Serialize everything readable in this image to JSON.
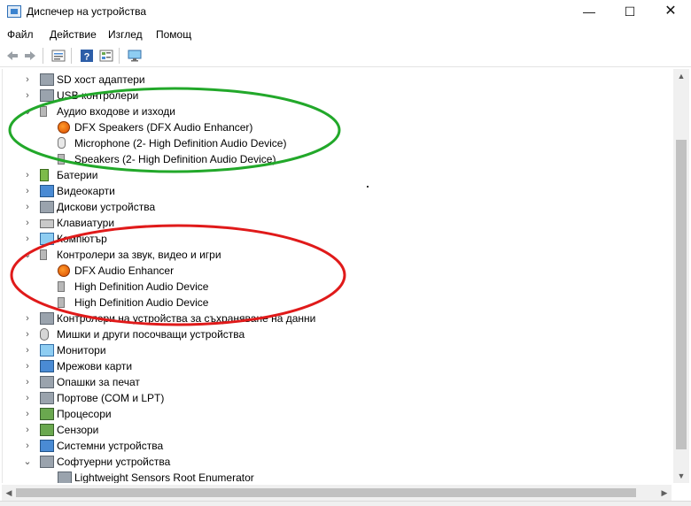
{
  "window": {
    "title": "Диспечер на устройства",
    "minimize_glyph": "—",
    "maximize_glyph": "☐",
    "close_glyph": "✕"
  },
  "menu": [
    "Файл",
    "Действие",
    "Изглед",
    "Помощ"
  ],
  "toolbar": {
    "icons": [
      "back-arrow-icon",
      "forward-arrow-icon",
      "properties-icon",
      "help-icon",
      "view-icon",
      "monitor-icon"
    ]
  },
  "tree": {
    "rows": [
      {
        "label": "SD хост адаптери",
        "level": 0,
        "state": "collapsed",
        "icon": "sd-card-icon"
      },
      {
        "label": "USB контролери",
        "level": 0,
        "state": "collapsed",
        "icon": "usb-icon"
      },
      {
        "label": "Аудио входове и изходи",
        "level": 0,
        "state": "expanded",
        "icon": "speaker-icon"
      },
      {
        "label": "DFX Speakers (DFX Audio Enhancer)",
        "level": 1,
        "state": "",
        "icon": "dfx-icon"
      },
      {
        "label": "Microphone (2- High Definition Audio Device)",
        "level": 1,
        "state": "",
        "icon": "microphone-icon"
      },
      {
        "label": "Speakers (2- High Definition Audio Device)",
        "level": 1,
        "state": "",
        "icon": "speaker-icon"
      },
      {
        "label": "Батерии",
        "level": 0,
        "state": "collapsed",
        "icon": "battery-icon"
      },
      {
        "label": "Видеокарти",
        "level": 0,
        "state": "collapsed",
        "icon": "display-adapter-icon"
      },
      {
        "label": "Дискови устройства",
        "level": 0,
        "state": "collapsed",
        "icon": "disk-drive-icon"
      },
      {
        "label": "Клавиатури",
        "level": 0,
        "state": "collapsed",
        "icon": "keyboard-icon"
      },
      {
        "label": "Компютър",
        "level": 0,
        "state": "collapsed",
        "icon": "computer-icon"
      },
      {
        "label": "Контролери за звук, видео и игри",
        "level": 0,
        "state": "expanded",
        "icon": "speaker-icon"
      },
      {
        "label": "DFX Audio Enhancer",
        "level": 1,
        "state": "",
        "icon": "dfx-icon"
      },
      {
        "label": "High Definition Audio Device",
        "level": 1,
        "state": "",
        "icon": "speaker-icon"
      },
      {
        "label": "High Definition Audio Device",
        "level": 1,
        "state": "",
        "icon": "speaker-icon"
      },
      {
        "label": "Контролери на устройства за съхраняване на данни",
        "level": 0,
        "state": "collapsed",
        "icon": "storage-controller-icon"
      },
      {
        "label": "Мишки и други посочващи устройства",
        "level": 0,
        "state": "collapsed",
        "icon": "mouse-icon"
      },
      {
        "label": "Монитори",
        "level": 0,
        "state": "collapsed",
        "icon": "monitor-icon"
      },
      {
        "label": "Мрежови карти",
        "level": 0,
        "state": "collapsed",
        "icon": "network-adapter-icon"
      },
      {
        "label": "Опашки за печат",
        "level": 0,
        "state": "collapsed",
        "icon": "printer-icon"
      },
      {
        "label": "Портове (COM и LPT)",
        "level": 0,
        "state": "collapsed",
        "icon": "port-icon"
      },
      {
        "label": "Процесори",
        "level": 0,
        "state": "collapsed",
        "icon": "processor-icon"
      },
      {
        "label": "Сензори",
        "level": 0,
        "state": "collapsed",
        "icon": "sensor-icon"
      },
      {
        "label": "Системни устройства",
        "level": 0,
        "state": "collapsed",
        "icon": "system-device-icon"
      },
      {
        "label": "Софтуерни устройства",
        "level": 0,
        "state": "expanded",
        "icon": "software-device-icon"
      },
      {
        "label": "Lightweight Sensors Root Enumerator",
        "level": 1,
        "state": "",
        "icon": "software-device-icon"
      }
    ]
  },
  "annotations": {
    "green_color": "#22a82a",
    "red_color": "#e01a1a"
  }
}
